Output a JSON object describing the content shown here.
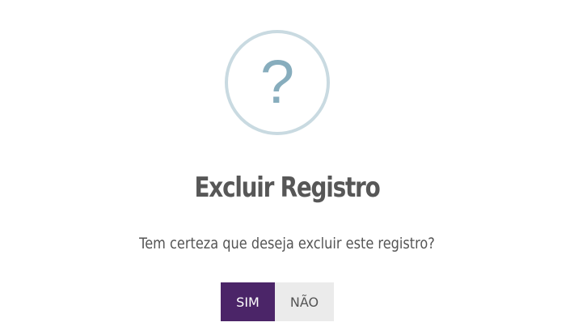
{
  "dialog": {
    "icon": {
      "name": "question-mark-icon",
      "glyph": "?",
      "ring_color": "#c9dae1",
      "glyph_color": "#87adbd"
    },
    "title": "Excluir Registro",
    "message": "Tem certeza que deseja excluir este registro?",
    "buttons": {
      "confirm_label": "SIM",
      "confirm_color": "#4b2568",
      "cancel_label": "NÃO",
      "cancel_color": "#ebebeb"
    }
  }
}
